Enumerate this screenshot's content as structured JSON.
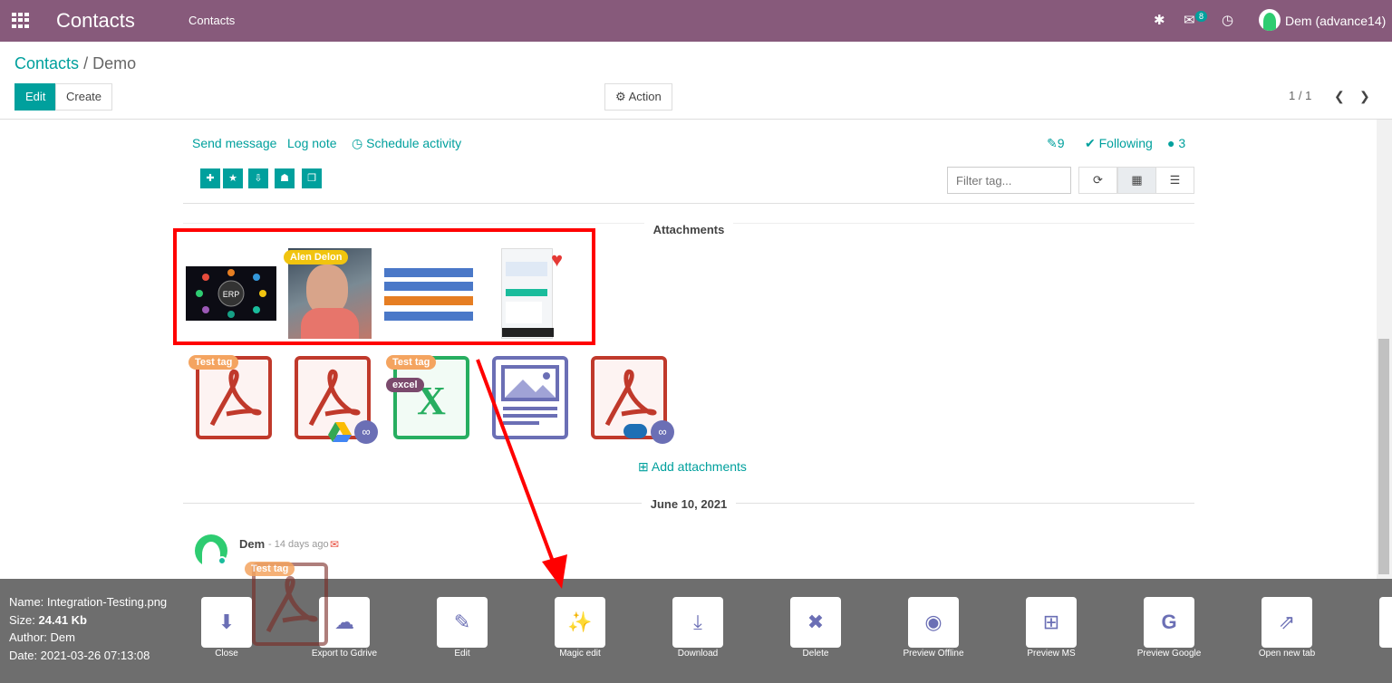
{
  "topbar": {
    "brand": "Contacts",
    "menu": "Contacts",
    "chat_count": "8",
    "user": "Dem (advance14)"
  },
  "breadcrumb": {
    "parent": "Contacts",
    "sep": "/",
    "current": "Demo"
  },
  "buttons": {
    "edit": "Edit",
    "create": "Create",
    "action": "Action"
  },
  "pager": {
    "text": "1 / 1"
  },
  "chatter": {
    "send_message": "Send message",
    "log_note": "Log note",
    "schedule": "Schedule activity",
    "attachments_count": "9",
    "following": "Following",
    "followers": "3",
    "filter_placeholder": "Filter tag...",
    "attachments_title": "Attachments",
    "add_attachments": "Add attachments",
    "date_sep": "June 10, 2021"
  },
  "thumbs": [
    {
      "name": "ERP"
    },
    {
      "tag": "Alen Delon"
    },
    {
      "name": "buttons-thumb"
    },
    {
      "name": "form-thumb"
    }
  ],
  "files": [
    {
      "type": "pdf",
      "tag": "Test tag"
    },
    {
      "type": "pdf"
    },
    {
      "type": "xls",
      "tag": "Test tag",
      "tag2": "excel"
    },
    {
      "type": "image"
    },
    {
      "type": "pdf"
    }
  ],
  "message": {
    "author": "Dem",
    "ago": "- 14 days ago"
  },
  "preview": {
    "name": "Name: Integration-Testing.png",
    "size_label": "Size: ",
    "size": "24.41 Kb",
    "author": "Author: Dem",
    "date": "Date: 2021-03-26 07:13:08",
    "drag_tag": "Test tag",
    "actions": [
      "Close",
      "Export to Gdrive",
      "Edit",
      "Magic edit",
      "Download",
      "Delete",
      "Preview Offline",
      "Preview MS",
      "Preview Google",
      "Open new tab"
    ]
  },
  "colors": {
    "brand": "#875a7b",
    "accent": "#00a09d",
    "highlight": "#ff0000"
  }
}
